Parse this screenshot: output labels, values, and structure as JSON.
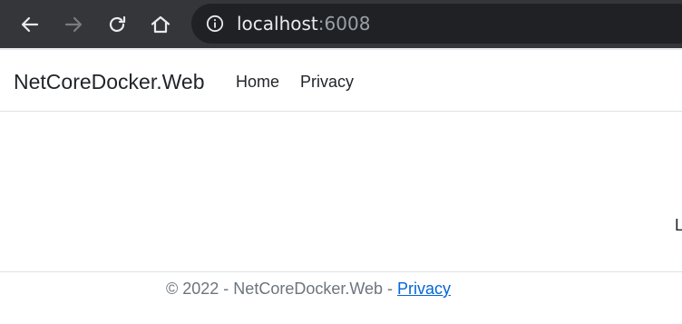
{
  "browser": {
    "url_host": "localhost",
    "url_port": ":6008",
    "icons": {
      "back": "arrow-left-icon",
      "forward": "arrow-right-icon",
      "reload": "reload-icon",
      "home": "home-icon",
      "site_info": "info-icon"
    }
  },
  "navbar": {
    "brand": "NetCoreDocker.Web",
    "links": [
      "Home",
      "Privacy"
    ]
  },
  "main": {
    "clipped_text": "L"
  },
  "footer": {
    "text": "© 2022 - NetCoreDocker.Web - ",
    "link": "Privacy"
  },
  "colors": {
    "toolbar_bg": "#35363a",
    "omnibox_bg": "#202124",
    "text": "#212529",
    "muted": "#6c757d",
    "link": "#0366d6"
  }
}
